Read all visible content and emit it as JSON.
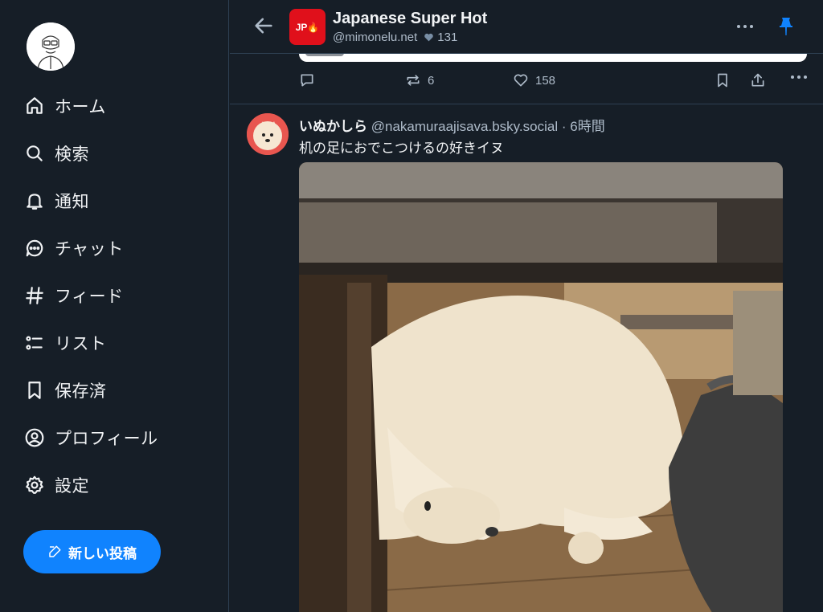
{
  "sidebar": {
    "nav": [
      {
        "label": "ホーム",
        "icon": "home-icon"
      },
      {
        "label": "検索",
        "icon": "search-icon"
      },
      {
        "label": "通知",
        "icon": "bell-icon"
      },
      {
        "label": "チャット",
        "icon": "chat-icon"
      },
      {
        "label": "フィード",
        "icon": "hash-icon"
      },
      {
        "label": "リスト",
        "icon": "list-icon"
      },
      {
        "label": "保存済",
        "icon": "bookmark-icon"
      },
      {
        "label": "プロフィール",
        "icon": "profile-icon"
      },
      {
        "label": "設定",
        "icon": "gear-icon"
      }
    ],
    "new_post_label": "新しい投稿"
  },
  "header": {
    "feed_avatar_text": "JP🔥",
    "title": "Japanese Super Hot",
    "handle": "@mimonelu.net",
    "likes": "131"
  },
  "prev_post": {
    "reposts": "6",
    "likes": "158"
  },
  "post": {
    "display_name": "いぬかしら",
    "handle": "@nakamuraajisava.bsky.social",
    "separator": "·",
    "time": "6時間",
    "text": "机の足におでこつけるの好きイヌ"
  },
  "colors": {
    "background": "#161e27",
    "border": "#2e4052",
    "accent": "#1083fe",
    "muted_text": "#aebbc9",
    "feed_avatar": "#e0101b"
  }
}
